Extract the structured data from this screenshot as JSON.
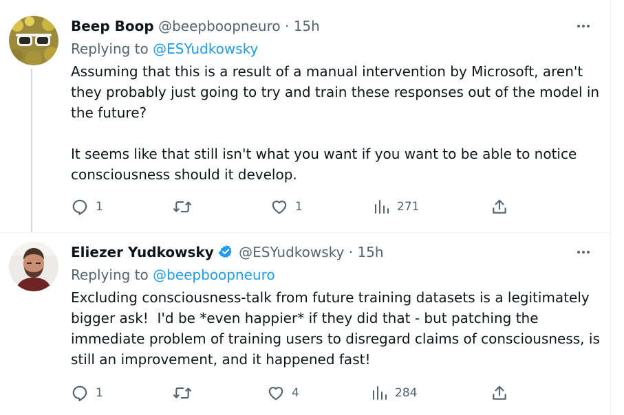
{
  "tweets": [
    {
      "name": "Beep Boop",
      "handle": "@beepboopneuro",
      "dot": "·",
      "time": "15h",
      "replying_prefix": "Replying to",
      "replying_to": "@ESYudkowsky",
      "paragraphs": [
        "Assuming that this is a result of a manual intervention by Microsoft, aren't they probably just going to try and train these responses out of the model in the future?",
        "It seems like that still isn't what you want if you want to be able to notice consciousness should it develop."
      ],
      "replies": "1",
      "retweets": "",
      "likes": "1",
      "views": "271",
      "verified": false,
      "icons": [
        "sunglasses-avatar",
        "more-icon",
        "reply-icon",
        "retweet-icon",
        "like-icon",
        "views-icon",
        "share-icon"
      ]
    },
    {
      "name": "Eliezer Yudkowsky",
      "handle": "@ESYudkowsky",
      "dot": "·",
      "time": "15h",
      "replying_prefix": "Replying to",
      "replying_to": "@beepboopneuro",
      "paragraphs": [
        "Excluding consciousness-talk from future training datasets is a legitimately bigger ask!  I'd be *even happier* if they did that - but patching the immediate problem of training users to disregard claims of consciousness, is still an improvement, and it happened fast!"
      ],
      "replies": "1",
      "retweets": "",
      "likes": "4",
      "views": "284",
      "verified": true,
      "icons": [
        "portrait-avatar",
        "verified-badge-icon",
        "more-icon",
        "reply-icon",
        "retweet-icon",
        "like-icon",
        "views-icon",
        "share-icon"
      ]
    }
  ],
  "colors": {
    "text": "#0f1419",
    "secondary": "#536471",
    "link": "#1d9bf0",
    "border": "#eff3f4",
    "thread_line": "#cfd9de"
  }
}
